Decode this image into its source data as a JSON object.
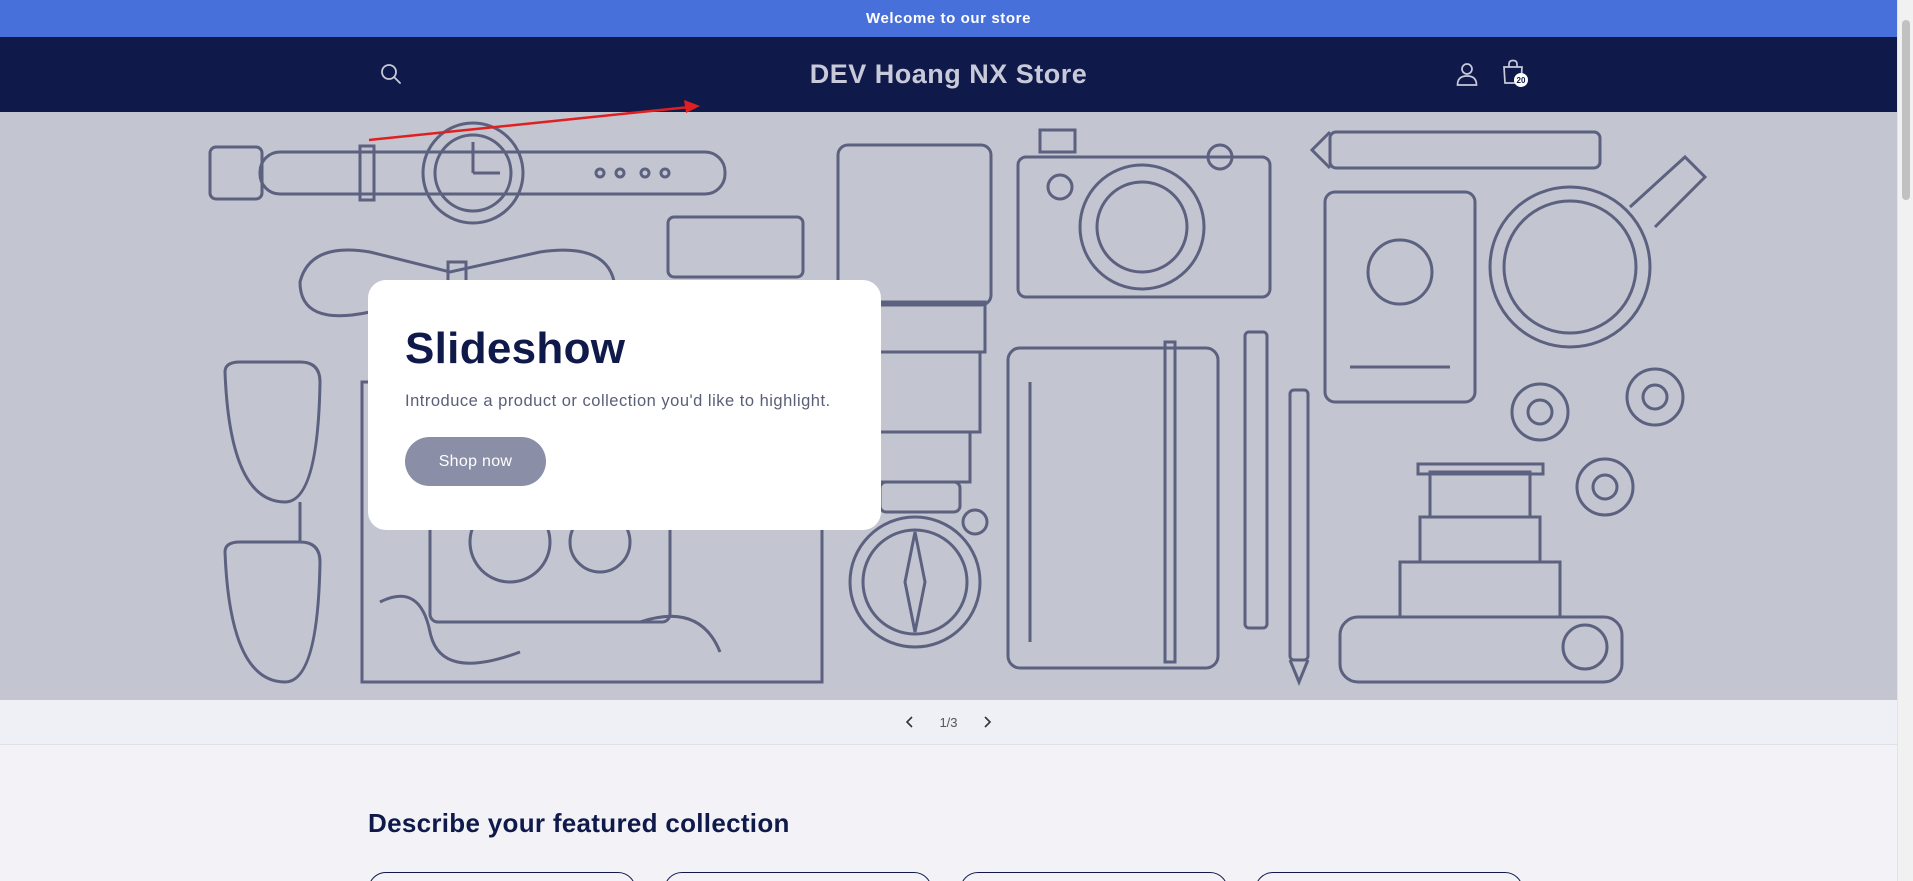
{
  "announcement": {
    "text": "Welcome to our store"
  },
  "header": {
    "store_name": "DEV Hoang NX Store",
    "cart_count": "20"
  },
  "hero": {
    "title": "Slideshow",
    "description": "Introduce a product or collection you'd like to highlight.",
    "button_label": "Shop now"
  },
  "slider": {
    "counter": "1/3",
    "prev_icon": "chevron-left-icon",
    "next_icon": "chevron-right-icon"
  },
  "featured": {
    "heading": "Describe your featured collection"
  },
  "colors": {
    "announcement_bg": "#4770db",
    "header_bg": "#0f1a4b",
    "hero_bg": "#c3c5d0",
    "line_art": "#5c6180",
    "annotation_arrow": "#e02020"
  }
}
